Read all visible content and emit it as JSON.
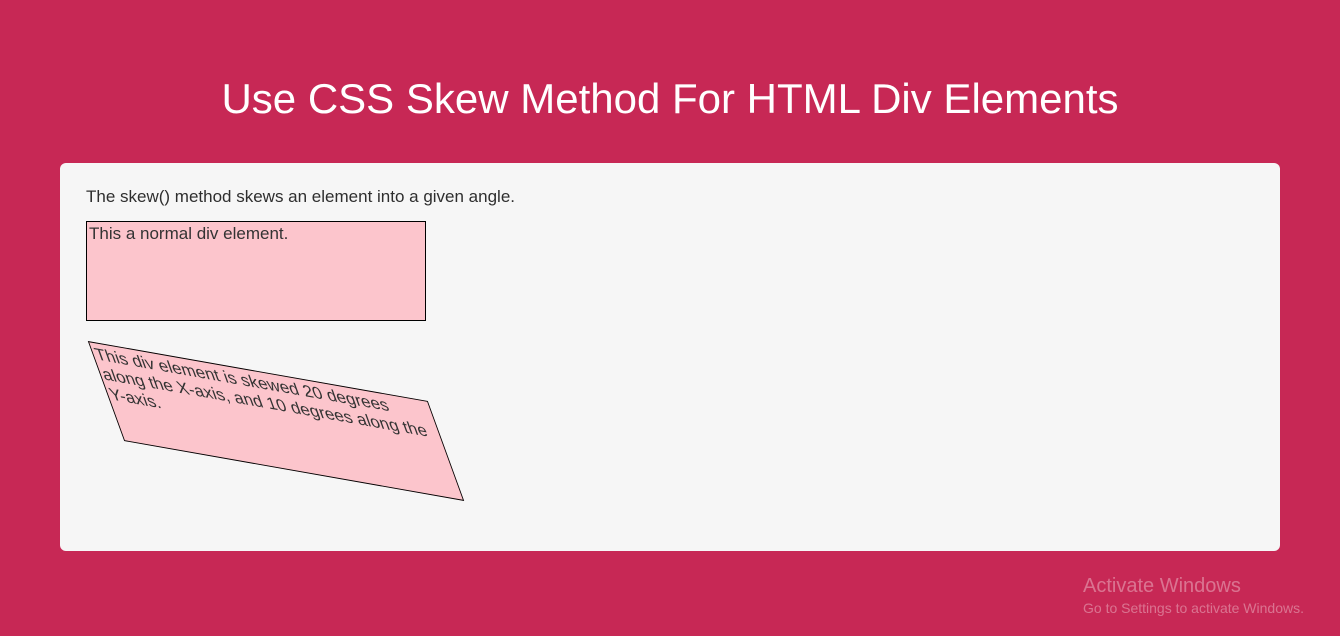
{
  "header": {
    "title": "Use CSS Skew Method For HTML Div Elements"
  },
  "content": {
    "description": "The skew() method skews an element into a given angle.",
    "normal_div_text": "This a normal div element.",
    "skewed_div_text": "This div element is skewed 20 degrees along the X-axis, and 10 degrees along the Y-axis."
  },
  "watermark": {
    "title": "Activate Windows",
    "subtitle": "Go to Settings to activate Windows."
  }
}
